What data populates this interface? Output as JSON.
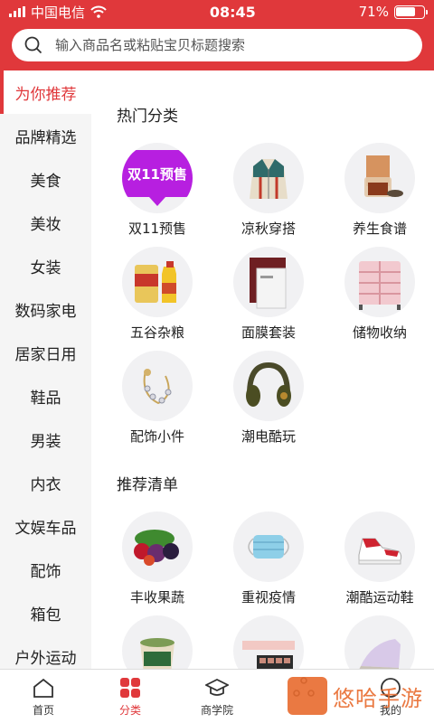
{
  "status": {
    "carrier": "中国电信",
    "time": "08:45",
    "battery": "71%",
    "battery_level": 0.71
  },
  "search": {
    "placeholder": "输入商品名或粘贴宝贝标题搜索"
  },
  "sidebar": {
    "items": [
      {
        "label": "为你推荐",
        "active": true
      },
      {
        "label": "品牌精选"
      },
      {
        "label": "美食"
      },
      {
        "label": "美妆"
      },
      {
        "label": "女装"
      },
      {
        "label": "数码家电"
      },
      {
        "label": "居家日用"
      },
      {
        "label": "鞋品"
      },
      {
        "label": "男装"
      },
      {
        "label": "内衣"
      },
      {
        "label": "文娱车品"
      },
      {
        "label": "配饰"
      },
      {
        "label": "箱包"
      },
      {
        "label": "户外运动"
      }
    ]
  },
  "hot": {
    "title": "热门分类",
    "items": [
      {
        "label": "双11预售",
        "icon": "double11-presale-icon"
      },
      {
        "label": "凉秋穿搭",
        "icon": "jacket-icon"
      },
      {
        "label": "养生食谱",
        "icon": "tea-icon"
      },
      {
        "label": "五谷杂粮",
        "icon": "rice-oil-icon"
      },
      {
        "label": "面膜套装",
        "icon": "face-mask-icon"
      },
      {
        "label": "储物收纳",
        "icon": "storage-drawer-icon"
      },
      {
        "label": "配饰小件",
        "icon": "bracelet-icon"
      },
      {
        "label": "潮电酷玩",
        "icon": "headphones-icon"
      }
    ],
    "badge_text": "双11预售"
  },
  "recommend": {
    "title": "推荐清单",
    "items": [
      {
        "label": "丰收果蔬",
        "icon": "fruit-icon"
      },
      {
        "label": "重视疫情",
        "icon": "medical-mask-icon"
      },
      {
        "label": "潮酷运动鞋",
        "icon": "sneaker-icon"
      },
      {
        "label": "",
        "icon": "snack-bowl-icon"
      },
      {
        "label": "",
        "icon": "eyeshadow-palette-icon"
      },
      {
        "label": "",
        "icon": "iron-icon"
      }
    ]
  },
  "tabbar": {
    "tabs": [
      {
        "label": "首页",
        "icon": "home-icon"
      },
      {
        "label": "分类",
        "icon": "category-icon",
        "active": true
      },
      {
        "label": "商学院",
        "icon": "graduation-cap-icon"
      },
      {
        "label": "",
        "icon": "share-icon"
      },
      {
        "label": "我的",
        "icon": "profile-icon"
      }
    ]
  },
  "watermark": {
    "text": "悠哈手游"
  },
  "colors": {
    "accent": "#e0383b",
    "sidebar_bg": "#f5f5f5",
    "purple": "#b71fe0"
  }
}
